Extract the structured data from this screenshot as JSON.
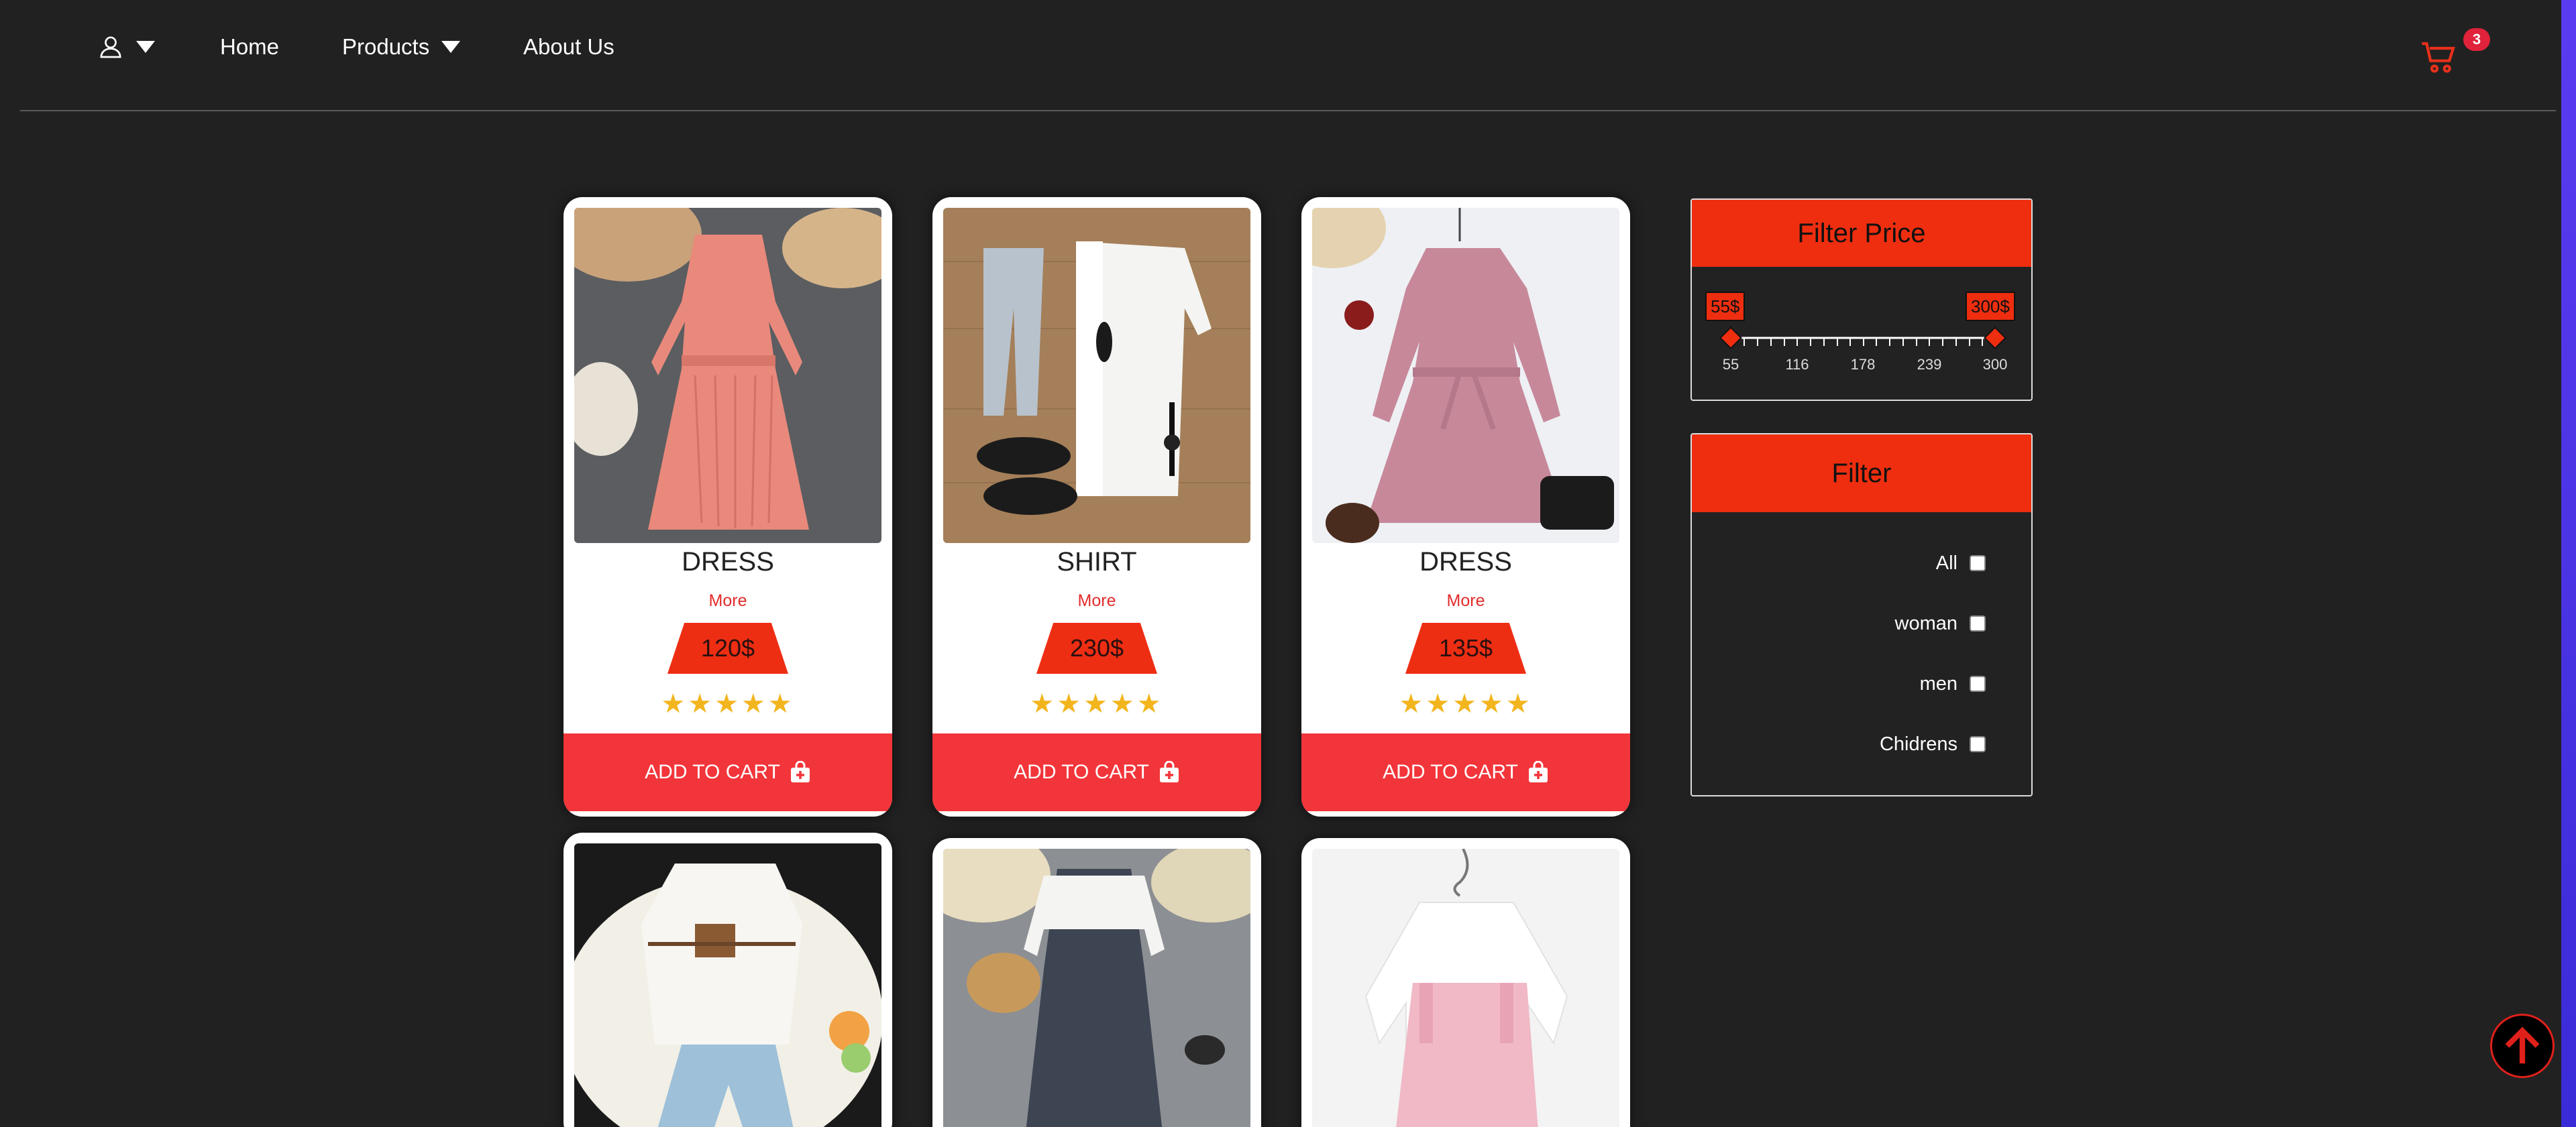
{
  "nav": {
    "items": [
      "Home",
      "Products",
      "About Us"
    ]
  },
  "cart": {
    "count": "3",
    "icon": "cart-icon",
    "color": "#e8301a"
  },
  "products": [
    {
      "title": "DRESS",
      "more": "More",
      "price": "120$",
      "stars": "★★★★★",
      "cta": "ADD TO CART",
      "rating": 5
    },
    {
      "title": "SHIRT",
      "more": "More",
      "price": "230$",
      "stars": "★★★★★",
      "cta": "ADD TO CART",
      "rating": 5
    },
    {
      "title": "DRESS",
      "more": "More",
      "price": "135$",
      "stars": "★★★★★",
      "cta": "ADD TO CART",
      "rating": 5
    }
  ],
  "filter_price": {
    "title": "Filter Price",
    "min_label": "55$",
    "max_label": "300$",
    "ticks": [
      "55",
      "116",
      "178",
      "239",
      "300"
    ],
    "min_value": 55,
    "max_value": 300
  },
  "filter": {
    "title": "Filter",
    "options": [
      "All",
      "woman",
      "men",
      "Chidrens"
    ]
  },
  "colors": {
    "accent": "#ee2e13",
    "cta": "#f2353a",
    "background": "#212121",
    "star": "#f2b51d"
  }
}
